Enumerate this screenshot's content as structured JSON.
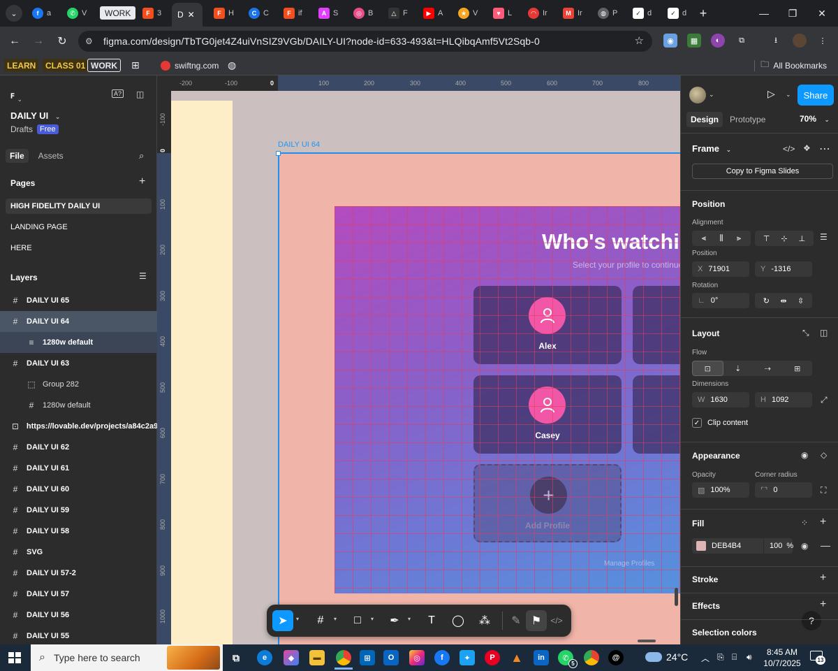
{
  "browser": {
    "tabs": [
      {
        "label": "a",
        "icon": "facebook-icon",
        "color": "#1877f2"
      },
      {
        "label": "V",
        "icon": "whatsapp-icon",
        "color": "#25d366"
      },
      {
        "label": "WORK",
        "icon": "group-label",
        "color": "#e8eaed"
      },
      {
        "label": "3",
        "icon": "figma-icon",
        "color": "#f24e1e"
      },
      {
        "label": "D",
        "icon": "active-tab",
        "color": "#35363a"
      },
      {
        "label": "H",
        "icon": "figma-icon",
        "color": "#f24e1e"
      },
      {
        "label": "C",
        "icon": "chrome-icon",
        "color": "#1a73e8"
      },
      {
        "label": "if",
        "icon": "figma-icon",
        "color": "#f24e1e"
      },
      {
        "label": "S",
        "icon": "app-icon",
        "color": "#e040fb"
      },
      {
        "label": "B",
        "icon": "dribbble-icon",
        "color": "#ea4c89"
      },
      {
        "label": "F",
        "icon": "app-icon",
        "color": "#333333"
      },
      {
        "label": "A",
        "icon": "youtube-icon",
        "color": "#ff0000"
      },
      {
        "label": "V",
        "icon": "star-badge-icon",
        "color": "#f5a623"
      },
      {
        "label": "L",
        "icon": "app-icon",
        "color": "#ff5a7a"
      },
      {
        "label": "Ir",
        "icon": "app-icon",
        "color": "#e53935"
      },
      {
        "label": "Ir",
        "icon": "gmail-icon",
        "color": "#ea4335"
      },
      {
        "label": "P",
        "icon": "globe-icon",
        "color": "#5f6368"
      },
      {
        "label": "d",
        "icon": "app-icon",
        "color": "#ffffff"
      },
      {
        "label": "d",
        "icon": "app-icon",
        "color": "#ffffff"
      }
    ],
    "url": "figma.com/design/TbTG0jet4Z4uiVnSIZ9VGb/DAILY-UI?node-id=633-493&t=HLQibqAmf5Vt2Sqb-0",
    "bookmarks": {
      "learn": "LEARN",
      "class": "CLASS 01",
      "work": "WORK",
      "swift": "swiftng.com",
      "all": "All Bookmarks"
    }
  },
  "figma": {
    "file": {
      "name": "DAILY UI",
      "location": "Drafts",
      "plan": "Free"
    },
    "left_tabs": {
      "file": "File",
      "assets": "Assets"
    },
    "pages_heading": "Pages",
    "pages": [
      {
        "label": "HIGH FIDELITY DAILY UI",
        "selected": true
      },
      {
        "label": "LANDING PAGE",
        "selected": false
      },
      {
        "label": "HERE",
        "selected": false
      }
    ],
    "layers_heading": "Layers",
    "layers": [
      {
        "label": "DAILY UI 65",
        "icon": "frame-icon",
        "depth": 0,
        "state": "normal"
      },
      {
        "label": "DAILY UI 64",
        "icon": "frame-icon",
        "depth": 0,
        "state": "selected"
      },
      {
        "label": "1280w default",
        "icon": "layout-icon",
        "depth": 1,
        "state": "child"
      },
      {
        "label": "DAILY UI 63",
        "icon": "frame-icon",
        "depth": 0,
        "state": "normal"
      },
      {
        "label": "Group 282",
        "icon": "group-icon",
        "depth": 1,
        "state": "soft"
      },
      {
        "label": "1280w default",
        "icon": "frame-icon",
        "depth": 1,
        "state": "soft"
      },
      {
        "label": "https://lovable.dev/projects/a84c2a9",
        "icon": "embed-icon",
        "depth": 0,
        "state": "normal"
      },
      {
        "label": "DAILY UI 62",
        "icon": "frame-icon",
        "depth": 0,
        "state": "normal"
      },
      {
        "label": "DAILY UI 61",
        "icon": "frame-icon",
        "depth": 0,
        "state": "normal"
      },
      {
        "label": "DAILY UI 60",
        "icon": "frame-icon",
        "depth": 0,
        "state": "normal"
      },
      {
        "label": "DAILY UI 59",
        "icon": "frame-icon",
        "depth": 0,
        "state": "normal"
      },
      {
        "label": "DAILY UI 58",
        "icon": "frame-icon",
        "depth": 0,
        "state": "normal"
      },
      {
        "label": "SVG",
        "icon": "frame-icon",
        "depth": 0,
        "state": "normal"
      },
      {
        "label": "DAILY UI 57-2",
        "icon": "frame-icon",
        "depth": 0,
        "state": "normal"
      },
      {
        "label": "DAILY UI 57",
        "icon": "frame-icon",
        "depth": 0,
        "state": "normal"
      },
      {
        "label": "DAILY UI 56",
        "icon": "frame-icon",
        "depth": 0,
        "state": "normal"
      },
      {
        "label": "DAILY UI 55",
        "icon": "frame-icon",
        "depth": 0,
        "state": "normal"
      }
    ],
    "canvas": {
      "ruler_top": [
        "-200",
        "-100",
        "0",
        "100",
        "200",
        "300",
        "400",
        "500",
        "600",
        "700",
        "800"
      ],
      "ruler_left": [
        "-100",
        "0",
        "100",
        "200",
        "300",
        "400",
        "500",
        "600",
        "700",
        "800",
        "900",
        "1000"
      ],
      "frame_label": "DAILY UI 64",
      "hero_title": "Who's watchin",
      "hero_subtitle": "Select your profile to continue",
      "profiles": [
        {
          "name": "Alex"
        },
        {
          "name": "Casey"
        }
      ],
      "add_profile": "Add Profile",
      "manage_profiles": "Manage Profiles"
    },
    "right": {
      "share": "Share",
      "tabs": {
        "design": "Design",
        "prototype": "Prototype"
      },
      "zoom": "70%",
      "frame_type": "Frame",
      "copy_slides": "Copy to Figma Slides",
      "position": {
        "heading": "Position",
        "alignment": "Alignment",
        "position_label": "Position",
        "x_key": "X",
        "x": "71901",
        "y_key": "Y",
        "y": "-1316",
        "rotation_label": "Rotation",
        "rotation": "0°"
      },
      "layout": {
        "heading": "Layout",
        "flow": "Flow",
        "dimensions": "Dimensions",
        "w_key": "W",
        "w": "1630",
        "h_key": "H",
        "h": "1092",
        "clip": "Clip content"
      },
      "appearance": {
        "heading": "Appearance",
        "opacity_label": "Opacity",
        "opacity": "100%",
        "radius_label": "Corner radius",
        "radius": "0"
      },
      "fill": {
        "heading": "Fill",
        "hex": "DEB4B4",
        "pct": "100",
        "pct_unit": "%",
        "color": "#DEB4B4"
      },
      "stroke": "Stroke",
      "effects": "Effects",
      "selection_colors": "Selection colors",
      "help": "?"
    }
  },
  "taskbar": {
    "search_placeholder": "Type here to search",
    "weather": "24°C",
    "time": "8:45 AM",
    "date": "10/7/2025",
    "notifications": "13",
    "whatsapp_badge": "5"
  }
}
